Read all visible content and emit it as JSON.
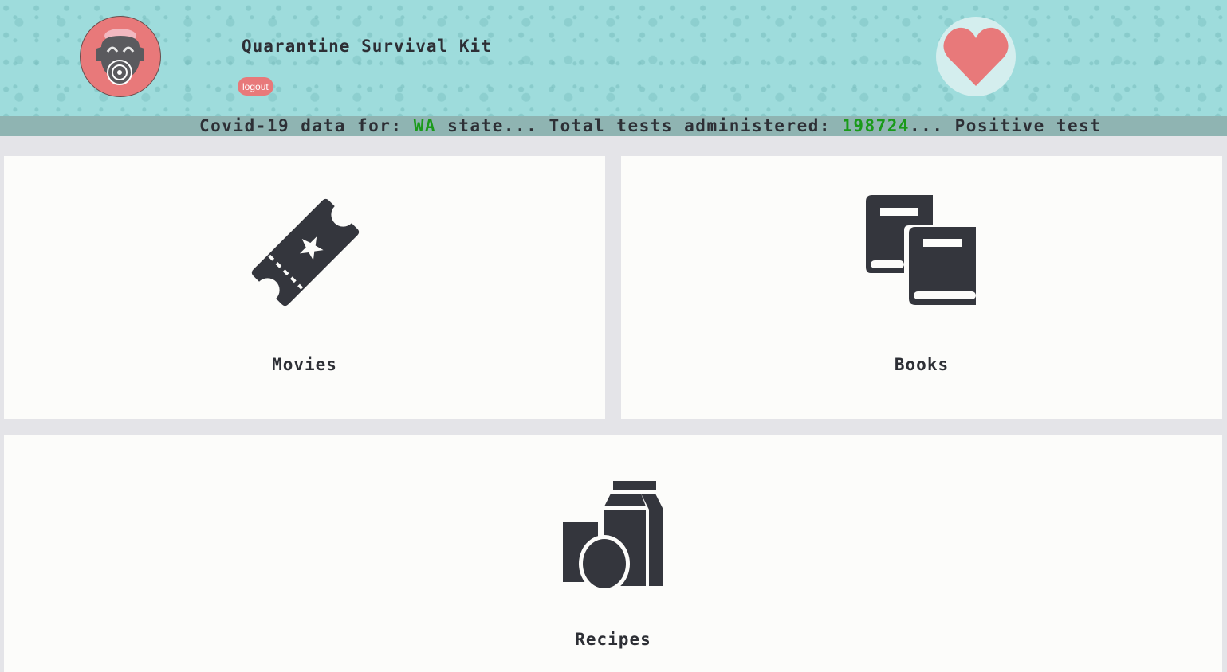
{
  "header": {
    "title": "Quarantine Survival Kit",
    "logout_label": "logout"
  },
  "ticker": {
    "prefix": "Covid-19 data for: ",
    "state": "WA",
    "mid": " state... Total tests administered: ",
    "tests": "198724",
    "suffix": "... Positive test"
  },
  "cards": {
    "movies": {
      "label": "Movies",
      "icon": "ticket-icon"
    },
    "books": {
      "label": "Books",
      "icon": "books-icon"
    },
    "recipes": {
      "label": "Recipes",
      "icon": "groceries-icon"
    }
  },
  "colors": {
    "header_bg": "#9edcdc",
    "accent": "#e8797a",
    "icon": "#34363d",
    "highlight": "#1a9a1a"
  }
}
